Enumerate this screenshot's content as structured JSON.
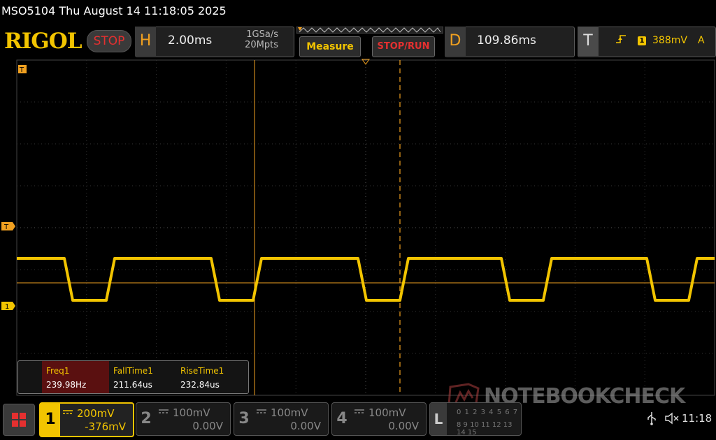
{
  "title_bar": {
    "text": "MSO5104  Thu August 14 11:18:05 2025"
  },
  "header": {
    "logo": "RIGOL",
    "run_state": "STOP",
    "horizontal": {
      "letter": "H",
      "timebase": "2.00ms",
      "sample_rate": "1GSa/s",
      "mem_depth": "20Mpts"
    },
    "measure_label": "Measure",
    "stoprun_label": "STOP/RUN",
    "delay": {
      "letter": "D",
      "value": "109.86ms"
    },
    "trigger": {
      "letter": "T",
      "source": "1",
      "level": "388mV",
      "mode": "A"
    }
  },
  "markers": {
    "trigger_marker": "T",
    "ch1_marker": "1",
    "top_marker": "T"
  },
  "measurements": [
    {
      "name": "Freq1",
      "value": "239.98Hz"
    },
    {
      "name": "FallTime1",
      "value": "211.64us"
    },
    {
      "name": "RiseTime1",
      "value": "232.84us"
    }
  ],
  "channels": [
    {
      "num": "1",
      "scale": "200mV",
      "offset": "-376mV",
      "active": true
    },
    {
      "num": "2",
      "scale": "100mV",
      "offset": "0.00V",
      "active": false
    },
    {
      "num": "3",
      "scale": "100mV",
      "offset": "0.00V",
      "active": false
    },
    {
      "num": "4",
      "scale": "100mV",
      "offset": "0.00V",
      "active": false
    }
  ],
  "logic": {
    "letter": "L",
    "row1": "0 1 2 3 4 5 6 7",
    "row2": "8 9 10 11 12 13 14 15"
  },
  "status": {
    "clock": "11:18"
  },
  "watermark": {
    "text": "NOTEBOOKCHECK"
  },
  "colors": {
    "ch1": "#f2c400",
    "trigger": "#f0a020",
    "grid": "#3a3a3a",
    "stop": "#e53030"
  },
  "icons": {
    "home": "menu-grid-icon",
    "usb": "usb-icon",
    "sound": "speaker-muted-icon"
  }
}
